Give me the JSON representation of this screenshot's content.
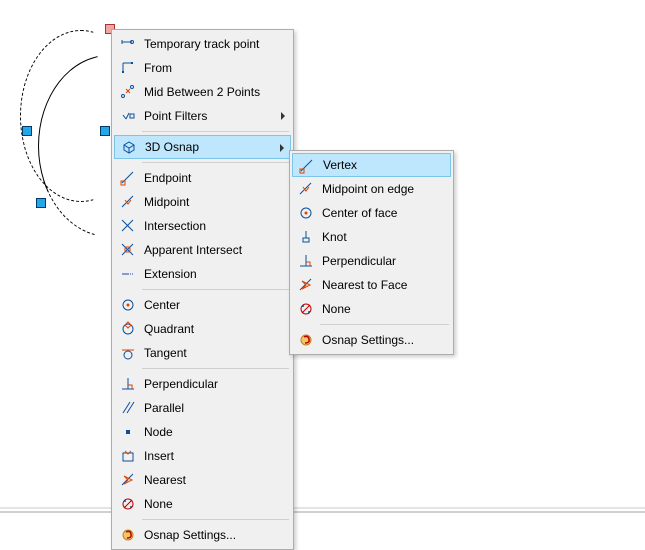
{
  "menu1": {
    "group1": [
      {
        "icon": "temp-track-icon",
        "label": "Temporary track point"
      },
      {
        "icon": "from-icon",
        "label": "From"
      },
      {
        "icon": "mid-between-icon",
        "label": "Mid Between 2 Points"
      },
      {
        "icon": "point-filters-icon",
        "label": "Point Filters",
        "submenu": true
      }
    ],
    "group2": [
      {
        "icon": "3d-osnap-icon",
        "label": "3D Osnap",
        "submenu": true,
        "highlight": true
      }
    ],
    "group3": [
      {
        "icon": "endpoint-icon",
        "label": "Endpoint"
      },
      {
        "icon": "midpoint-icon",
        "label": "Midpoint"
      },
      {
        "icon": "intersection-icon",
        "label": "Intersection"
      },
      {
        "icon": "apparent-intersect-icon",
        "label": "Apparent Intersect"
      },
      {
        "icon": "extension-icon",
        "label": "Extension"
      }
    ],
    "group4": [
      {
        "icon": "center-icon",
        "label": "Center"
      },
      {
        "icon": "quadrant-icon",
        "label": "Quadrant"
      },
      {
        "icon": "tangent-icon",
        "label": "Tangent"
      }
    ],
    "group5": [
      {
        "icon": "perpendicular-icon",
        "label": "Perpendicular"
      },
      {
        "icon": "parallel-icon",
        "label": "Parallel"
      },
      {
        "icon": "node-icon",
        "label": "Node"
      },
      {
        "icon": "insert-icon",
        "label": "Insert"
      },
      {
        "icon": "nearest-icon",
        "label": "Nearest"
      },
      {
        "icon": "none-icon",
        "label": "None"
      }
    ],
    "group6": [
      {
        "icon": "osnap-settings-icon",
        "label": "Osnap Settings..."
      }
    ]
  },
  "menu2": {
    "group1": [
      {
        "icon": "vertex-icon",
        "label": "Vertex",
        "highlight": true
      },
      {
        "icon": "midpoint-edge-icon",
        "label": "Midpoint on edge"
      },
      {
        "icon": "center-face-icon",
        "label": "Center of face"
      },
      {
        "icon": "knot-icon",
        "label": "Knot"
      },
      {
        "icon": "perpendicular-icon",
        "label": "Perpendicular"
      },
      {
        "icon": "nearest-face-icon",
        "label": "Nearest to Face"
      },
      {
        "icon": "none-icon",
        "label": "None"
      }
    ],
    "group2": [
      {
        "icon": "osnap-settings-icon",
        "label": "Osnap Settings..."
      }
    ]
  },
  "icons": {
    "temp-track-icon": "<svg width='16' height='16'><line x1='2' y1='6' x2='12' y2='6' stroke='#0a4f9e'/><circle cx='12' cy='6' r='1.5' fill='none' stroke='#0a4f9e'/><line x1='2' y1='4' x2='2' y2='8' stroke='#0a4f9e'/></svg>",
    "from-icon": "<svg width='16' height='16'><line x1='3' y1='3' x2='3' y2='12' stroke='#0a4f9e'/><line x1='3' y1='3' x2='12' y2='3' stroke='#0a4f9e'/><rect x='11' y='2' width='2' height='2' fill='#0a4f9e'/><rect x='2' y='11' width='2' height='2' fill='#0a4f9e'/></svg>",
    "mid-between-icon": "<svg width='16' height='16'><circle cx='3' cy='12' r='1.5' fill='none' stroke='#0a4f9e'/><circle cx='12' cy='3' r='1.5' fill='none' stroke='#0a4f9e'/><line x1='6' y1='5' x2='10' y2='9' stroke='#d40'/><line x1='6' y1='9' x2='10' y2='5' stroke='#d40'/></svg>",
    "point-filters-icon": "<svg width='16' height='16'><line x1='3' y1='7' x2='6' y2='11' stroke='#0a4f9e'/><line x1='6' y1='11' x2='9' y2='5' stroke='#0a4f9e'/><rect x='10' y='6' width='4' height='4' fill='none' stroke='#0a4f9e'/></svg>",
    "3d-osnap-icon": "<svg width='16' height='16'><path d='M3 10 L8 13 L13 10 L13 5 L8 2 L3 5 Z M8 13 L8 8 M3 5 L8 8 L13 5' fill='none' stroke='#0a4f9e'/></svg>",
    "endpoint-icon": "<svg width='16' height='16'><line x1='2' y1='13' x2='13' y2='2' stroke='#0a4f9e'/><rect x='1' y='11' width='4' height='4' fill='none' stroke='#d40'/></svg>",
    "midpoint-icon": "<svg width='16' height='16'><line x1='2' y1='13' x2='13' y2='2' stroke='#0a4f9e'/><path d='M5 6 L8 10 L11 6' fill='none' stroke='#d40'/></svg>",
    "intersection-icon": "<svg width='16' height='16'><line x1='2' y1='2' x2='13' y2='13' stroke='#0a4f9e'/><line x1='2' y1='13' x2='13' y2='2' stroke='#0a4f9e'/></svg>",
    "apparent-intersect-icon": "<svg width='16' height='16'><line x1='2' y1='2' x2='13' y2='13' stroke='#0a4f9e'/><line x1='2' y1='13' x2='13' y2='2' stroke='#0a4f9e'/><rect x='5' y='5' width='5' height='5' fill='none' stroke='#d40'/></svg>",
    "extension-icon": "<svg width='16' height='16'><line x1='2' y1='8' x2='8' y2='8' stroke='#0a4f9e'/><line x1='8' y1='8' x2='14' y2='8' stroke='#0a4f9e' stroke-dasharray='1 1'/></svg>",
    "center-icon": "<svg width='16' height='16'><circle cx='8' cy='8' r='5' fill='none' stroke='#0a4f9e'/><circle cx='8' cy='8' r='1.5' fill='#d40'/></svg>",
    "quadrant-icon": "<svg width='16' height='16'><circle cx='8' cy='8' r='5' fill='none' stroke='#0a4f9e'/><path d='M8 1 L11 4 L8 7 L5 4 Z' fill='none' stroke='#d40'/></svg>",
    "tangent-icon": "<svg width='16' height='16'><circle cx='8' cy='10' r='4' fill='none' stroke='#0a4f9e'/><line x1='2' y1='5' x2='14' y2='5' stroke='#d40'/></svg>",
    "perpendicular-icon": "<svg width='16' height='16'><line x1='2' y1='13' x2='14' y2='13' stroke='#0a4f9e'/><line x1='8' y1='13' x2='8' y2='2' stroke='#0a4f9e'/><path d='M8 9 L12 9 L12 13' fill='none' stroke='#d40'/></svg>",
    "parallel-icon": "<svg width='16' height='16'><line x1='3' y1='13' x2='10' y2='2' stroke='#0a4f9e'/><line x1='7' y1='13' x2='14' y2='2' stroke='#0a4f9e'/></svg>",
    "node-icon": "<svg width='16' height='16'><rect x='6' y='6' width='4' height='4' fill='#0a4f9e'/></svg>",
    "insert-icon": "<svg width='16' height='16'><rect x='3' y='5' width='10' height='8' fill='none' stroke='#0a4f9e'/><path d='M5 3 L8 6 L11 3' fill='none' stroke='#d40'/></svg>",
    "nearest-icon": "<svg width='16' height='16'><line x1='2' y1='13' x2='13' y2='2' stroke='#0a4f9e'/><path d='M4 4 L8 8 L4 12 L12 8 Z' fill='none' stroke='#d40'/></svg>",
    "none-icon": "<svg width='16' height='16'><circle cx='8' cy='8' r='5' fill='none' stroke='#b00'/><line x1='4' y1='12' x2='12' y2='4' stroke='#b00'/><circle cx='5' cy='5' r='1' fill='#0a4f9e'/><circle cx='11' cy='11' r='1' fill='#0a4f9e'/></svg>",
    "osnap-settings-icon": "<svg width='16' height='16'><circle cx='8' cy='8' r='5' fill='#f4c56a' stroke='#c08020'/><path d='M6 5 Q10 3 11 7 Q12 11 7 11' fill='none' stroke='#b00' stroke-width='1.5'/></svg>",
    "vertex-icon": "<svg width='16' height='16'><line x1='2' y1='13' x2='13' y2='2' stroke='#0a4f9e'/><rect x='1' y='11' width='4' height='4' fill='none' stroke='#d40'/></svg>",
    "midpoint-edge-icon": "<svg width='16' height='16'><line x1='2' y1='13' x2='13' y2='2' stroke='#0a4f9e'/><path d='M5 6 L8 10 L11 6' fill='none' stroke='#d40'/></svg>",
    "center-face-icon": "<svg width='16' height='16'><circle cx='8' cy='8' r='5' fill='none' stroke='#0a4f9e'/><circle cx='8' cy='8' r='1.5' fill='#d40'/></svg>",
    "knot-icon": "<svg width='16' height='16'><line x1='8' y1='2' x2='8' y2='9' stroke='#0a4f9e'/><rect x='5' y='9' width='6' height='4' fill='none' stroke='#0a4f9e'/></svg>",
    "nearest-face-icon": "<svg width='16' height='16'><line x1='2' y1='13' x2='13' y2='2' stroke='#0a4f9e'/><path d='M4 4 L8 8 L4 12 L12 8 Z' fill='none' stroke='#d40'/></svg>"
  }
}
